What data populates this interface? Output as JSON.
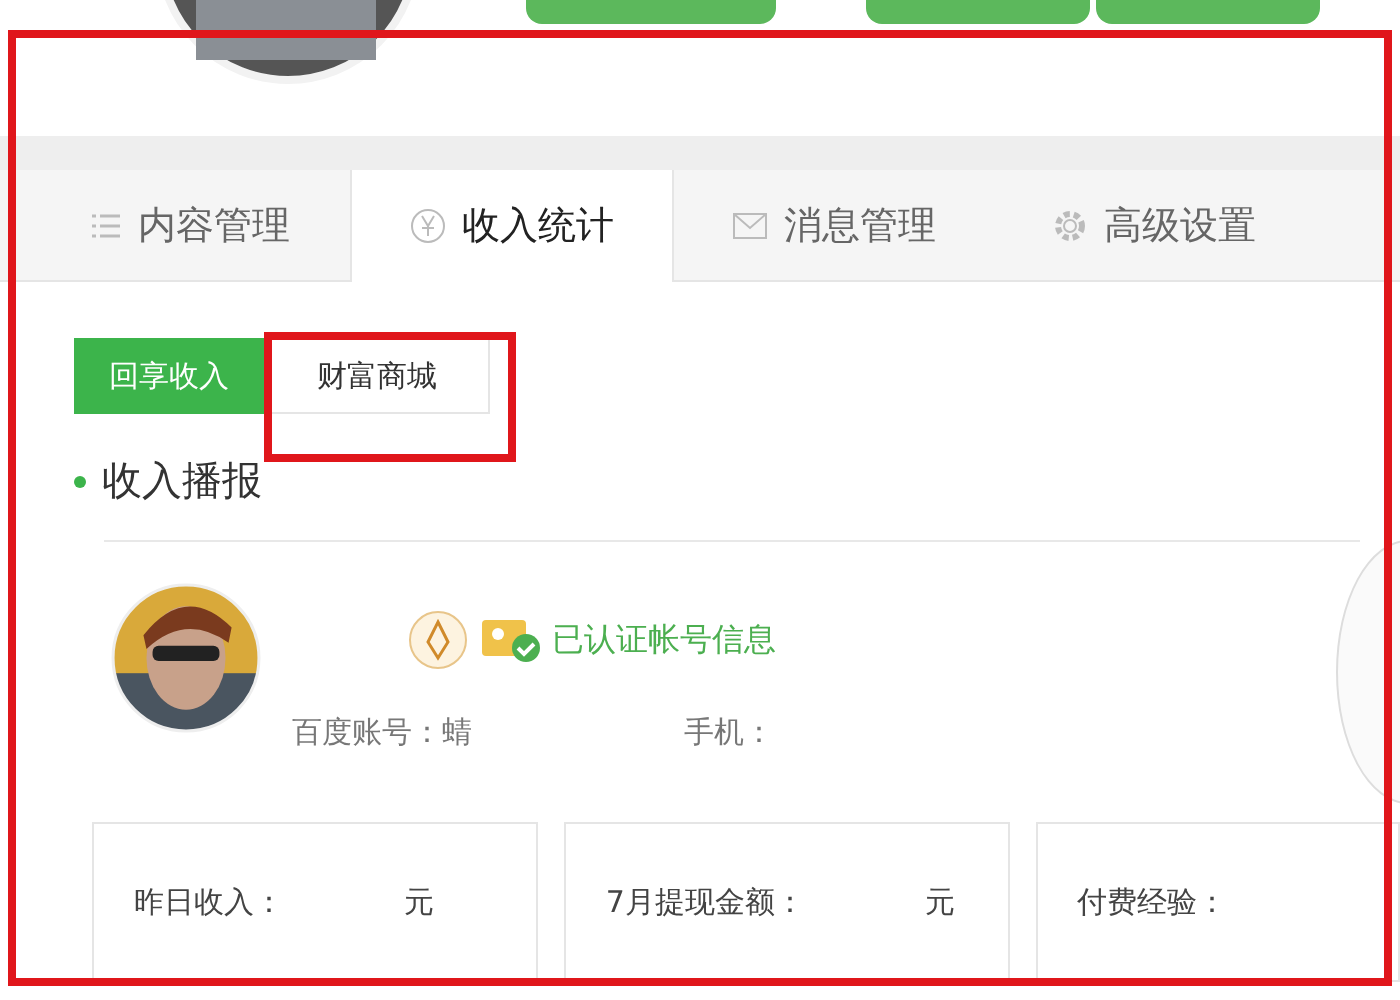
{
  "tabs": [
    {
      "label": "内容管理",
      "kind": "list",
      "selected": false
    },
    {
      "label": "收入统计",
      "kind": "yen",
      "selected": true
    },
    {
      "label": "消息管理",
      "kind": "mail",
      "selected": false
    },
    {
      "label": "高级设置",
      "kind": "gear",
      "selected": false
    }
  ],
  "subtabs": [
    {
      "label": "回享收入",
      "selected": true
    },
    {
      "label": "财富商城",
      "selected": false
    }
  ],
  "section_title": "收入播报",
  "profile": {
    "verified_label": "已认证帐号信息",
    "account_label": "百度账号：蜻",
    "phone_label": "手机："
  },
  "cards": [
    {
      "label": "昨日收入：",
      "unit": "元"
    },
    {
      "label": "7月提现金额：",
      "unit": "元"
    },
    {
      "label": "付费经验："
    }
  ]
}
